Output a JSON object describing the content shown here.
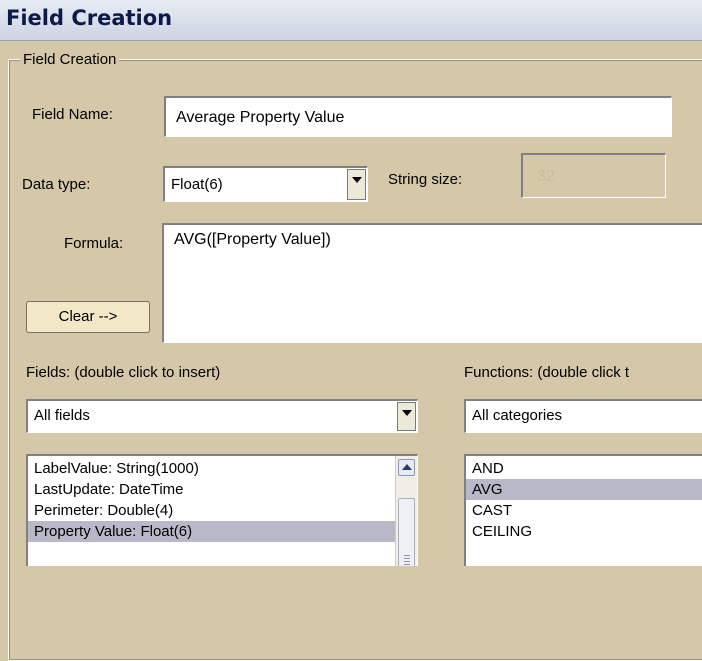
{
  "window": {
    "title": "Field Creation"
  },
  "group": {
    "legend": "Field Creation"
  },
  "field_name": {
    "label": "Field Name:",
    "value": "Average Property Value"
  },
  "data_type": {
    "label": "Data type:",
    "selected": "Float(6)"
  },
  "string_size": {
    "label": "String size:",
    "value": "32"
  },
  "formula": {
    "label": "Formula:",
    "value": "AVG([Property Value])",
    "clear_button": "Clear -->"
  },
  "fields": {
    "label": "Fields: (double click to insert)",
    "filter_selected": "All fields",
    "items": [
      {
        "label": "LabelValue: String(1000)",
        "selected": false
      },
      {
        "label": "LastUpdate: DateTime",
        "selected": false
      },
      {
        "label": "Perimeter: Double(4)",
        "selected": false
      },
      {
        "label": "Property Value: Float(6)",
        "selected": true
      }
    ]
  },
  "functions": {
    "label": "Functions: (double click t",
    "filter_selected": "All categories",
    "items": [
      {
        "label": "AND",
        "selected": false
      },
      {
        "label": "AVG",
        "selected": true
      },
      {
        "label": "CAST",
        "selected": false
      },
      {
        "label": "CEILING",
        "selected": false
      }
    ]
  },
  "icons": {
    "dropdown": "chevron-down-icon",
    "scroll_up": "scroll-up-arrow-icon",
    "scroll_grip": "scroll-grip-icon"
  }
}
